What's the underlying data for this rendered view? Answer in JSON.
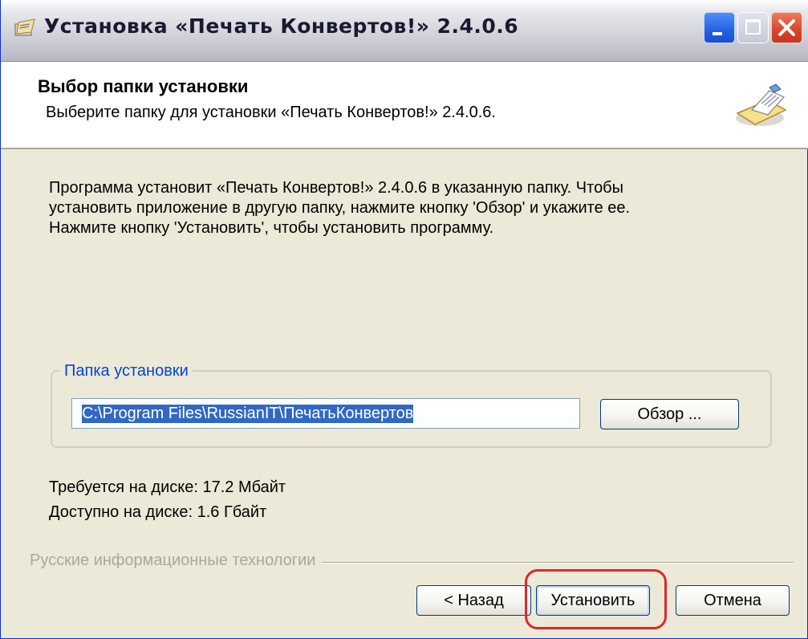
{
  "window": {
    "title": "Установка «Печать Конвертов!» 2.4.0.6"
  },
  "header": {
    "title": "Выбор папки установки",
    "subtitle": "Выберите папку для установки «Печать Конвертов!» 2.4.0.6.",
    "icon": "installer-wizard-icon"
  },
  "description": [
    "Программа установит «Печать Конвертов!» 2.4.0.6 в указанную папку. Чтобы",
    "установить приложение в другую папку, нажмите кнопку 'Обзор' и укажите ее.",
    "Нажмите кнопку 'Установить', чтобы установить программу."
  ],
  "folder_group": {
    "legend": "Папка установки",
    "path_value": "C:\\Program Files\\RussianIT\\ПечатьКонвертов",
    "browse_label": "Обзор ..."
  },
  "disk": {
    "required": "Требуется на диске: 17.2 Мбайт",
    "available": "Доступно на диске: 1.6 Гбайт"
  },
  "footer": {
    "brand": "Русские информационные технологии",
    "back_label": "< Назад",
    "install_label": "Установить",
    "cancel_label": "Отмена"
  },
  "colors": {
    "highlight": "#e3262b",
    "legend": "#0046d5",
    "selection": "#3168c5"
  }
}
